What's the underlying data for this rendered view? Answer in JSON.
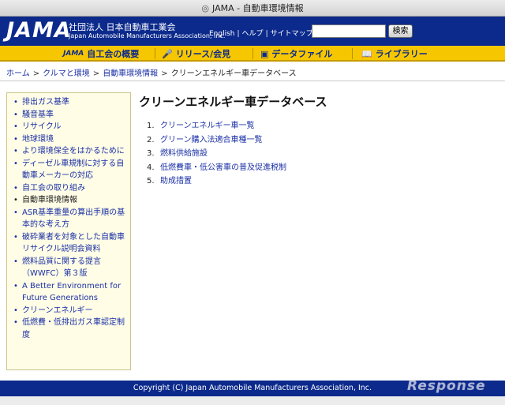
{
  "window": {
    "title": "JAMA - 自動車環境情報",
    "icon": "globe-icon"
  },
  "header": {
    "logo": "JAMA",
    "org_jp": "社団法人 日本自動車工業会",
    "org_en": "Japan Automobile Manufacturers Association, Inc.",
    "links": [
      "English",
      "ヘルプ",
      "サイトマップ"
    ],
    "link_separator": "|",
    "search_value": "",
    "search_button": "検索"
  },
  "nav": {
    "items": [
      {
        "label": "自工会の概要",
        "icon_text": "JAMA",
        "icon": "jama-mark-icon"
      },
      {
        "label": "リリース/会見",
        "icon_text": "🎤",
        "icon": "microphone-icon"
      },
      {
        "label": "データファイル",
        "icon_text": "▣",
        "icon": "data-file-icon"
      },
      {
        "label": "ライブラリー",
        "icon_text": "📖",
        "icon": "book-icon"
      }
    ]
  },
  "breadcrumb": {
    "items": [
      "ホーム",
      "クルマと環境",
      "自動車環境情報",
      "クリーンエネルギー車データベース"
    ],
    "separator": ">"
  },
  "sidebar": {
    "bullet": "•",
    "items": [
      {
        "label": "排出ガス基準",
        "current": false
      },
      {
        "label": "騒音基準",
        "current": false
      },
      {
        "label": "リサイクル",
        "current": false
      },
      {
        "label": "地球環境",
        "current": false
      },
      {
        "label": "より環境保全をはかるために",
        "current": false
      },
      {
        "label": "ディーゼル車規制に対する自動車メーカーの対応",
        "current": false
      },
      {
        "label": "自工会の取り組み",
        "current": false
      },
      {
        "label": "自動車環境情報",
        "current": true
      },
      {
        "label": "ASR基準重量の算出手順の基本的な考え方",
        "current": false
      },
      {
        "label": "破砕業者を対象とした自動車リサイクル説明会資料",
        "current": false
      },
      {
        "label": "燃料品質に関する提言（WWFC）第３版",
        "current": false
      },
      {
        "label": "A Better Environment for Future Generations",
        "current": false
      },
      {
        "label": "クリーンエネルギー",
        "current": false
      },
      {
        "label": "低燃費・低排出ガス車認定制度",
        "current": false
      }
    ]
  },
  "main": {
    "title": "クリーンエネルギー車データベース",
    "items": [
      {
        "num": "1.",
        "label": "クリーンエネルギー車一覧"
      },
      {
        "num": "2.",
        "label": "グリーン購入法適合車種一覧"
      },
      {
        "num": "3.",
        "label": "燃料供給施設"
      },
      {
        "num": "4.",
        "label": "低燃費車・低公害車の普及促進税制"
      },
      {
        "num": "5.",
        "label": "助成措置"
      }
    ]
  },
  "footer": {
    "copyright": "Copyright (C) Japan Automobile Manufacturers Association, Inc."
  },
  "watermark": "Response",
  "colors": {
    "brand_blue": "#0c2a8c",
    "nav_yellow": "#f6c700",
    "link_blue": "#1a2fa6",
    "sidebar_bg": "#fffde6"
  }
}
